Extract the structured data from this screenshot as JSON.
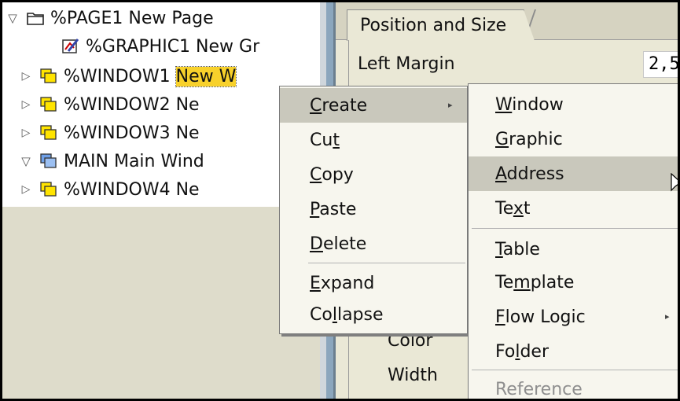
{
  "tree": {
    "items": [
      {
        "toggle": "▽",
        "icon": "folder-page-icon",
        "text": "%PAGE1 New Page"
      },
      {
        "toggle": "",
        "icon": "graphic-icon",
        "text": "%GRAPHIC1 New Gr"
      },
      {
        "toggle": "▷",
        "icon": "window-icon",
        "text_pre": "%WINDOW1 ",
        "text_hl": "New W"
      },
      {
        "toggle": "▷",
        "icon": "window-icon",
        "text": "%WINDOW2 Ne"
      },
      {
        "toggle": "▷",
        "icon": "window-icon",
        "text": "%WINDOW3 Ne"
      },
      {
        "toggle": "▽",
        "icon": "main-window-icon",
        "text": "MAIN Main Wind"
      },
      {
        "toggle": "▷",
        "icon": "window-icon",
        "text": "%WINDOW4 Ne"
      }
    ]
  },
  "right_panel": {
    "tab_label": "Position and Size",
    "left_margin_label": "Left Margin",
    "left_margin_value": "2,5",
    "color_label": "Color",
    "width_label": "Width"
  },
  "context_menu": {
    "items": [
      {
        "pre": "",
        "u": "C",
        "post": "reate",
        "submenu": true
      },
      {
        "pre": "Cu",
        "u": "t",
        "post": ""
      },
      {
        "pre": "",
        "u": "C",
        "post": "opy"
      },
      {
        "pre": "",
        "u": "P",
        "post": "aste"
      },
      {
        "pre": "",
        "u": "D",
        "post": "elete"
      },
      {
        "pre": "",
        "u": "E",
        "post": "xpand"
      },
      {
        "pre": "Co",
        "u": "l",
        "post": "lapse"
      }
    ]
  },
  "create_submenu": {
    "items": [
      {
        "pre": "",
        "u": "W",
        "post": "indow"
      },
      {
        "pre": "",
        "u": "G",
        "post": "raphic"
      },
      {
        "pre": "",
        "u": "A",
        "post": "ddress"
      },
      {
        "pre": "Te",
        "u": "x",
        "post": "t"
      },
      {
        "pre": "",
        "u": "T",
        "post": "able"
      },
      {
        "pre": "Te",
        "u": "m",
        "post": "plate"
      },
      {
        "pre": "",
        "u": "F",
        "post": "low Logic",
        "submenu": true
      },
      {
        "pre": "Fo",
        "u": "l",
        "post": "der"
      },
      {
        "pre": "Reference",
        "u": "",
        "post": "",
        "disabled": true
      }
    ]
  },
  "colors": {
    "highlight": "#f8d12b",
    "menu_bg": "#f7f6ee",
    "menu_active": "#c9c8bc",
    "panel_bg": "#eae8d6"
  }
}
